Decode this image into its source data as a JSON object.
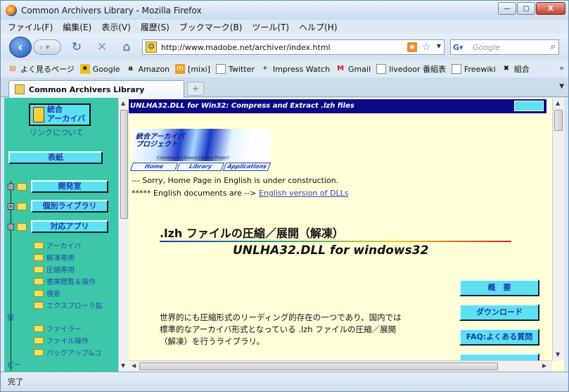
{
  "window": {
    "title": "Common Archivers Library - Mozilla Firefox",
    "controls": {
      "minimize": "—",
      "maximize": "▢",
      "close": "X"
    }
  },
  "menubar": [
    "ファイル(F)",
    "編集(E)",
    "表示(V)",
    "履歴(S)",
    "ブックマーク(B)",
    "ツール(T)",
    "ヘルプ(H)"
  ],
  "navbar": {
    "url": "http://www.madobe.net/archiver/index.html",
    "search_placeholder": "Google",
    "icons": {
      "back": "back-arrow-icon",
      "forward": "forward-arrow-icon",
      "reload": "reload-icon",
      "stop": "stop-icon",
      "home": "home-icon"
    }
  },
  "bookmarks": [
    {
      "label": "よく見るページ",
      "icon": "rss-folder-icon"
    },
    {
      "label": "Google",
      "icon": "google-icon"
    },
    {
      "label": "Amazon",
      "icon": "amazon-icon"
    },
    {
      "label": "[mixi]",
      "icon": "mixi-icon"
    },
    {
      "label": "Twitter",
      "icon": "page-icon"
    },
    {
      "label": "Impress Watch",
      "icon": "impress-icon"
    },
    {
      "label": "Gmail",
      "icon": "gmail-icon"
    },
    {
      "label": "livedoor 番組表",
      "icon": "page-icon"
    },
    {
      "label": "Freewiki",
      "icon": "page-icon"
    },
    {
      "label": "組合",
      "icon": "x-icon"
    }
  ],
  "bookmarks_more": "»",
  "tab": {
    "label": "Common Archivers Library",
    "new_tab": "+"
  },
  "left_frame": {
    "logo_line1": "統合",
    "logo_line2": "アーカイバ",
    "link_about": "リンクについて",
    "cover": "表紙",
    "tree": [
      {
        "toggle": "⊟",
        "label": "開発室"
      },
      {
        "toggle": "⊞",
        "label": "個別ライブラリ"
      },
      {
        "toggle": "⊟",
        "label": "対応アプリ"
      }
    ],
    "sub_items": [
      "アーカイバ",
      "解凍専用",
      "圧縮専用",
      "書庫閲覧＆操作",
      "検索",
      "エクスプローラ拡"
    ],
    "wrap_1": "張",
    "sub_items_2": [
      "ファイラー",
      "ファイル操作",
      "バックアップ&コ"
    ],
    "wrap_2": "ピー"
  },
  "right_frame": {
    "header": "UNLHA32.DLL for Win32: Compress and Extract .lzh files",
    "banner_title_1": "統合アーカイバ",
    "banner_title_2": "プロジェクト",
    "banner_sub": "Common Archivers Library Project",
    "banner_tabs": [
      "Home",
      "Library",
      "Applications"
    ],
    "sorry_text": "--- Sorry, Home Page in English is under construction.",
    "english_prefix": "***** English documents are -->",
    "english_link": "English version of DLLs",
    "heading_lzh": ".lzh ファイルの圧縮／展開（解凍）",
    "heading_unlha": "UNLHA32.DLL for windows32",
    "description": "世界的にも圧縮形式のリーディング的存在の一つであり、国内では標準的なアーカイバ形式となっている .lzh ファイルの圧縮／展開（解凍）を行うライブラリ。",
    "buttons": [
      "概　要",
      "ダウンロード",
      "FAQ:よくある質問"
    ]
  },
  "status": "完了"
}
